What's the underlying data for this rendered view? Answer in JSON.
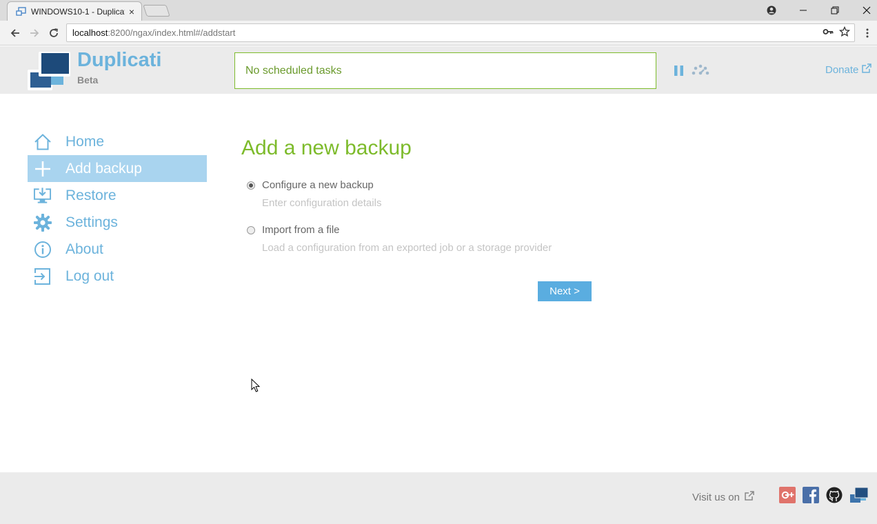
{
  "browser": {
    "tab_title": "WINDOWS10-1 - Duplicati",
    "tab_close": "×",
    "url_host": "localhost",
    "url_path": ":8200/ngax/index.html#/addstart"
  },
  "header": {
    "brand": "Duplicati",
    "edition": "Beta",
    "status_text": "No scheduled tasks",
    "donate_label": "Donate"
  },
  "sidebar": {
    "items": [
      {
        "label": "Home",
        "icon": "home-icon",
        "active": false
      },
      {
        "label": "Add backup",
        "icon": "plus-icon",
        "active": true
      },
      {
        "label": "Restore",
        "icon": "restore-icon",
        "active": false
      },
      {
        "label": "Settings",
        "icon": "gear-icon",
        "active": false
      },
      {
        "label": "About",
        "icon": "info-icon",
        "active": false
      },
      {
        "label": "Log out",
        "icon": "logout-icon",
        "active": false
      }
    ]
  },
  "main": {
    "title": "Add a new backup",
    "options": [
      {
        "label": "Configure a new backup",
        "description": "Enter configuration details",
        "selected": true
      },
      {
        "label": "Import from a file",
        "description": "Load a configuration from an exported job or a storage provider",
        "selected": false
      }
    ],
    "next_label": "Next >"
  },
  "footer": {
    "visit_label": "Visit us on"
  },
  "colors": {
    "accent_blue": "#6cb3dc",
    "accent_green": "#7dbb2b",
    "active_nav": "#a9d4ef",
    "button_blue": "#5aade0"
  }
}
